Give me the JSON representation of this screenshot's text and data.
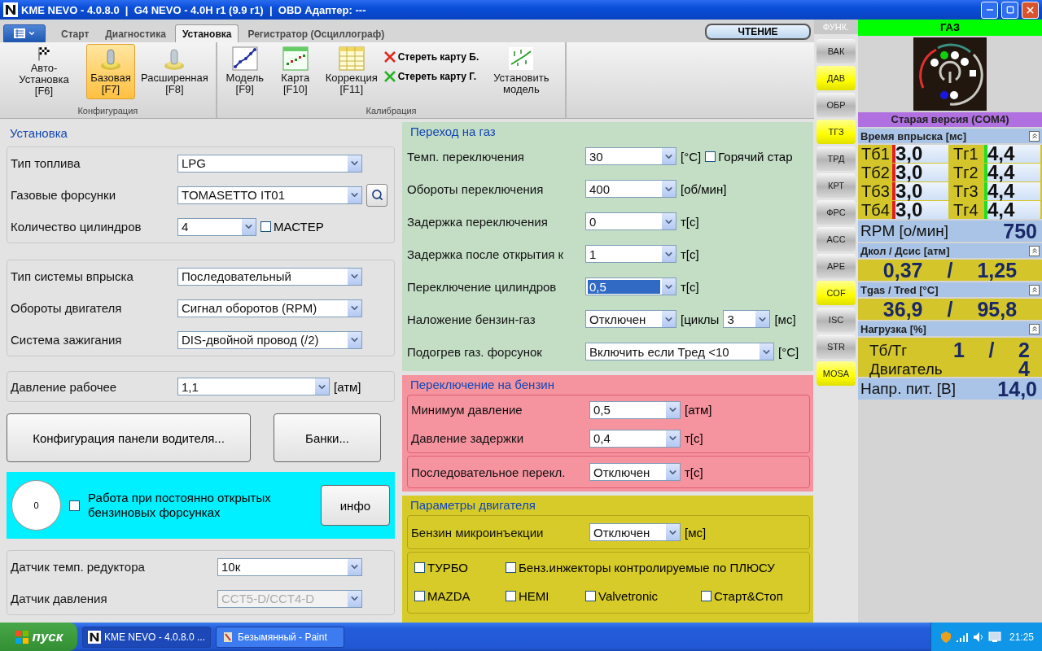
{
  "window": {
    "title": "KME NEVO - 4.0.8.0  |  G4 NEVO - 4.0H r1 (9.9 r1)  |  OBD Адаптер: ---"
  },
  "ribbon": {
    "tabs": [
      {
        "label": "Старт",
        "selected": false
      },
      {
        "label": "Диагностика",
        "selected": false
      },
      {
        "label": "Установка",
        "selected": true
      },
      {
        "label": "Регистратор (Осциллограф)",
        "selected": false
      }
    ],
    "read_button": "ЧТЕНИЕ",
    "groups": [
      {
        "label": "Конфигурация",
        "items": [
          {
            "kind": "large",
            "label": "Авто-Установка",
            "key": "[F6]",
            "selected": false
          },
          {
            "kind": "large",
            "label": "Базовая",
            "key": "[F7]",
            "selected": true
          },
          {
            "kind": "large",
            "label": "Расширенная",
            "key": "[F8]",
            "selected": false
          }
        ]
      },
      {
        "label": "Калибрация",
        "items": [
          {
            "kind": "large",
            "label": "Модель",
            "key": "[F9]",
            "selected": false
          },
          {
            "kind": "large",
            "label": "Карта",
            "key": "[F10]",
            "selected": false
          },
          {
            "kind": "large",
            "label": "Коррекция",
            "key": "[F11]",
            "selected": false
          },
          {
            "kind": "stack",
            "actions": [
              {
                "label": "Стереть карту Б.",
                "color": "#e0281e"
              },
              {
                "label": "Стереть карту Г.",
                "color": "#24b424"
              }
            ]
          },
          {
            "kind": "large",
            "label": "Установить модель",
            "selected": false
          }
        ]
      }
    ]
  },
  "setup": {
    "title": "Установка",
    "groups": [
      {
        "rows": [
          {
            "label": "Тип топлива",
            "value": "LPG",
            "disabled": false
          },
          {
            "label": "Газовые форсунки",
            "value": "TOMASETTO IT01",
            "disabled": false,
            "search": true
          },
          {
            "label": "Количество цилиндров",
            "value": "4",
            "disabled": false,
            "check": {
              "label": "МАСТЕР",
              "checked": false
            }
          }
        ]
      },
      {
        "rows": [
          {
            "label": "Тип системы впрыска",
            "value": "Последовательный",
            "disabled": false
          },
          {
            "label": "Обороты двигателя",
            "value": "Сигнал оборотов (RPM)",
            "disabled": false
          },
          {
            "label": "Система зажигания",
            "value": "DIS-двойной провод (/2)",
            "disabled": false
          }
        ]
      },
      {
        "rows": [
          {
            "label": "Давление рабочее",
            "value": "1,1",
            "disabled": false,
            "unit": "[атм]"
          }
        ]
      },
      {
        "rows": [
          {
            "label": "Датчик темп. редуктора",
            "value": "10к",
            "disabled": false
          },
          {
            "label": "Датчик давления",
            "value": "CCT5-D/CCT4-D",
            "disabled": true
          }
        ]
      }
    ],
    "buttons": [
      "Конфигурация панели водителя...",
      "Банки..."
    ],
    "open_injectors": {
      "counter": "0",
      "checkbox": {
        "label": "Работа при постоянно открытых бензиновых форсунках",
        "checked": false
      },
      "button": "инфо"
    }
  },
  "gas_switch": {
    "title": "Переход на газ",
    "rows": [
      {
        "kind": "select",
        "label": "Темп. переключения",
        "value": "30",
        "unit": "[°C]",
        "selected": false,
        "check": {
          "label": "Горячий стар",
          "checked": false
        }
      },
      {
        "kind": "select",
        "label": "Обороты переключения",
        "value": "400",
        "unit": "[об/мин]",
        "selected": false
      },
      {
        "kind": "select",
        "label": "Задержка переключения",
        "value": "0",
        "unit": "т[с]",
        "selected": false
      },
      {
        "kind": "select",
        "label": "Задержка после открытия к",
        "value": "1",
        "unit": "т[с]",
        "selected": false
      },
      {
        "kind": "select",
        "label": "Переключение цилиндров",
        "value": "0,5",
        "unit": "т[с]",
        "selected": true
      },
      {
        "kind": "select-pair",
        "label": "Наложение бензин-газ",
        "value": "Отключен",
        "unit": "[циклы",
        "value2": "3",
        "unit2": "[мс]",
        "selected": false
      },
      {
        "kind": "wide-select",
        "label": "Подогрев газ. форсунок",
        "value": "Включить если Тред <10",
        "unit": "[°C]",
        "selected": false
      }
    ]
  },
  "petrol_switch": {
    "title": "Переключение на бензин",
    "groups": [
      {
        "rows": [
          {
            "kind": "select",
            "label": "Минимум давление",
            "value": "0,5",
            "unit": "[атм]"
          },
          {
            "kind": "select",
            "label": "Давление задержки",
            "value": "0,4",
            "unit": "т[с]"
          }
        ]
      },
      {
        "rows": [
          {
            "kind": "select",
            "label": "Последовательное перекл.",
            "value": "Отключен",
            "unit": "т[с]"
          }
        ]
      }
    ]
  },
  "engine_params": {
    "title": "Параметры двигателя",
    "rows": [
      {
        "kind": "select",
        "label": "Бензин микроинъекции",
        "value": "Отключен",
        "unit": "[мс]"
      }
    ],
    "option_rows": [
      {
        "options": [
          {
            "label": "ТУРБО",
            "checked": false
          },
          {
            "label": "Бенз.инжекторы контролируемые по ПЛЮСУ",
            "checked": false
          }
        ]
      },
      {
        "options": [
          {
            "label": "MAZDA",
            "checked": false
          },
          {
            "label": "HEMI",
            "checked": false
          },
          {
            "label": "Valvetronic",
            "checked": false
          },
          {
            "label": "Старт&Стоп",
            "checked": false
          }
        ]
      }
    ]
  },
  "functions": {
    "header": "ФУНК.",
    "buttons": [
      {
        "label": "ВАК",
        "on": false
      },
      {
        "label": "ДАВ",
        "on": true
      },
      {
        "label": "ОБР",
        "on": false
      },
      {
        "label": "ТГЗ",
        "on": true
      },
      {
        "label": "ТРД",
        "on": false
      },
      {
        "label": "КРТ",
        "on": false
      },
      {
        "label": "ФРС",
        "on": false
      },
      {
        "label": "ACC",
        "on": false
      },
      {
        "label": "APE",
        "on": false
      },
      {
        "label": "COF",
        "on": true
      },
      {
        "label": "ISC",
        "on": false
      },
      {
        "label": "STR",
        "on": false
      },
      {
        "label": "MOSA",
        "on": true
      }
    ]
  },
  "status": {
    "mode": "ГАЗ",
    "connection": "Старая версия (COM4)",
    "injection": {
      "title": "Время впрыска [мс]",
      "petrol": [
        {
          "label": "Тб1",
          "value": "3,0"
        },
        {
          "label": "Тб2",
          "value": "3,0"
        },
        {
          "label": "Тб3",
          "value": "3,0"
        },
        {
          "label": "Тб4",
          "value": "3,0"
        }
      ],
      "gas": [
        {
          "label": "Тг1",
          "value": "4,4"
        },
        {
          "label": "Тг2",
          "value": "4,4"
        },
        {
          "label": "Тг3",
          "value": "4,4"
        },
        {
          "label": "Тг4",
          "value": "4,4"
        }
      ]
    },
    "rpm": {
      "label": "RPM [о/мин]",
      "value": "750"
    },
    "pressure": {
      "title": "Дкол / Дсис [атм]",
      "values": [
        "0,37",
        "/",
        "1,25"
      ]
    },
    "temperature": {
      "title": "Tgas / Tred [°C]",
      "values": [
        "36,9",
        "/",
        "95,8"
      ]
    },
    "load": {
      "title": "Нагрузка [%]",
      "rows": [
        {
          "label": "Тб/Тг",
          "values": [
            "1",
            "/",
            "2"
          ]
        },
        {
          "label": "Двигатель",
          "values": [
            "4"
          ]
        }
      ]
    },
    "voltage": {
      "label": "Напр. пит. [В]",
      "value": "14,0"
    }
  },
  "taskbar": {
    "start": "пуск",
    "tasks": [
      {
        "label": "KME NEVO - 4.0.8.0 ...",
        "selected": true
      },
      {
        "label": "Безымянный - Paint",
        "selected": false
      }
    ],
    "clock": "21:25"
  }
}
